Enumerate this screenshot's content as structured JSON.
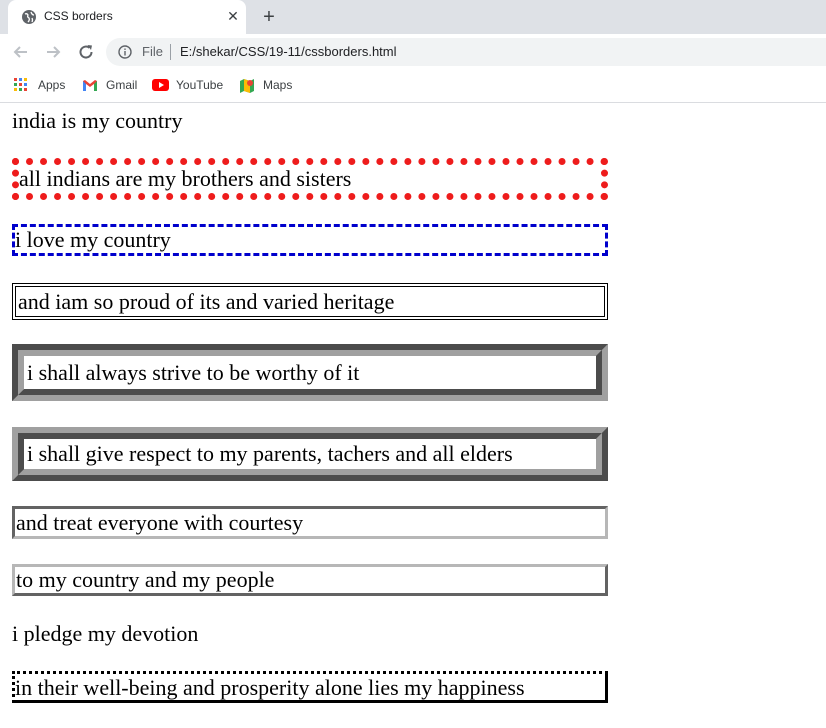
{
  "browser": {
    "tab": {
      "title": "CSS borders"
    },
    "address": {
      "scheme": "File",
      "url": "E:/shekar/CSS/19-11/cssborders.html"
    },
    "bookmarks": [
      {
        "label": "Apps",
        "icon": "apps-grid-icon"
      },
      {
        "label": "Gmail",
        "icon": "gmail-icon"
      },
      {
        "label": "YouTube",
        "icon": "youtube-icon"
      },
      {
        "label": "Maps",
        "icon": "maps-icon"
      }
    ]
  },
  "content": {
    "paragraphs": [
      "india is my country",
      "all indians are my brothers and sisters",
      "i love my country",
      "and iam so proud of its and varied heritage",
      "i shall always strive to be worthy of it",
      "i shall give respect to my parents, tachers and all elders",
      "and treat everyone with courtesy",
      "to my country and my people",
      "i pledge my devotion",
      "in their well-being and prosperity alone lies my happiness"
    ]
  },
  "colors": {
    "chrome_bg": "#dee1e6",
    "dotted_red": "#ee1c1c",
    "dashed_blue": "#0000cc",
    "groove_gray": "#a0a0a0"
  }
}
